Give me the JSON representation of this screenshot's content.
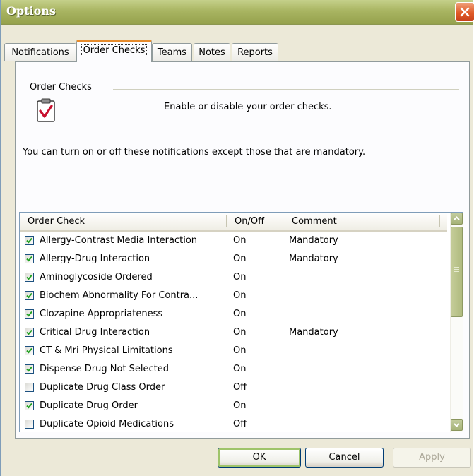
{
  "window": {
    "title": "Options"
  },
  "tabs": [
    {
      "label": "Notifications"
    },
    {
      "label": "Order Checks"
    },
    {
      "label": "Teams"
    },
    {
      "label": "Notes"
    },
    {
      "label": "Reports"
    }
  ],
  "panel": {
    "group_label": "Order Checks",
    "enable_text": "Enable or disable your order checks.",
    "description": "You can turn on or off these notifications except those that are mandatory."
  },
  "list": {
    "columns": [
      "Order Check",
      "On/Off",
      "Comment"
    ],
    "rows": [
      {
        "name": "Allergy-Contrast Media Interaction",
        "state": "On",
        "comment": "Mandatory",
        "checked": true
      },
      {
        "name": "Allergy-Drug Interaction",
        "state": "On",
        "comment": "Mandatory",
        "checked": true
      },
      {
        "name": "Aminoglycoside Ordered",
        "state": "On",
        "comment": "",
        "checked": true
      },
      {
        "name": "Biochem Abnormality For Contra...",
        "state": "On",
        "comment": "",
        "checked": true
      },
      {
        "name": "Clozapine Appropriateness",
        "state": "On",
        "comment": "",
        "checked": true
      },
      {
        "name": "Critical Drug Interaction",
        "state": "On",
        "comment": "Mandatory",
        "checked": true
      },
      {
        "name": "CT & Mri Physical Limitations",
        "state": "On",
        "comment": "",
        "checked": true
      },
      {
        "name": "Dispense Drug Not Selected",
        "state": "On",
        "comment": "",
        "checked": true
      },
      {
        "name": "Duplicate Drug Class Order",
        "state": "Off",
        "comment": "",
        "checked": false
      },
      {
        "name": "Duplicate Drug Order",
        "state": "On",
        "comment": "",
        "checked": true
      },
      {
        "name": "Duplicate Opioid Medications",
        "state": "Off",
        "comment": "",
        "checked": false
      }
    ]
  },
  "buttons": {
    "ok": "OK",
    "cancel": "Cancel",
    "apply": "Apply"
  },
  "icons": {
    "close": "close-icon",
    "clipboard": "clipboard-check-icon",
    "checkbox": "checkmark-icon",
    "scroll_up": "chevron-up-icon",
    "scroll_down": "chevron-down-icon"
  },
  "colors": {
    "title_bar": "#a9b562",
    "active_tab_accent": "#e68b2c",
    "checkmark": "#21a121",
    "close_button": "#e05b28"
  }
}
